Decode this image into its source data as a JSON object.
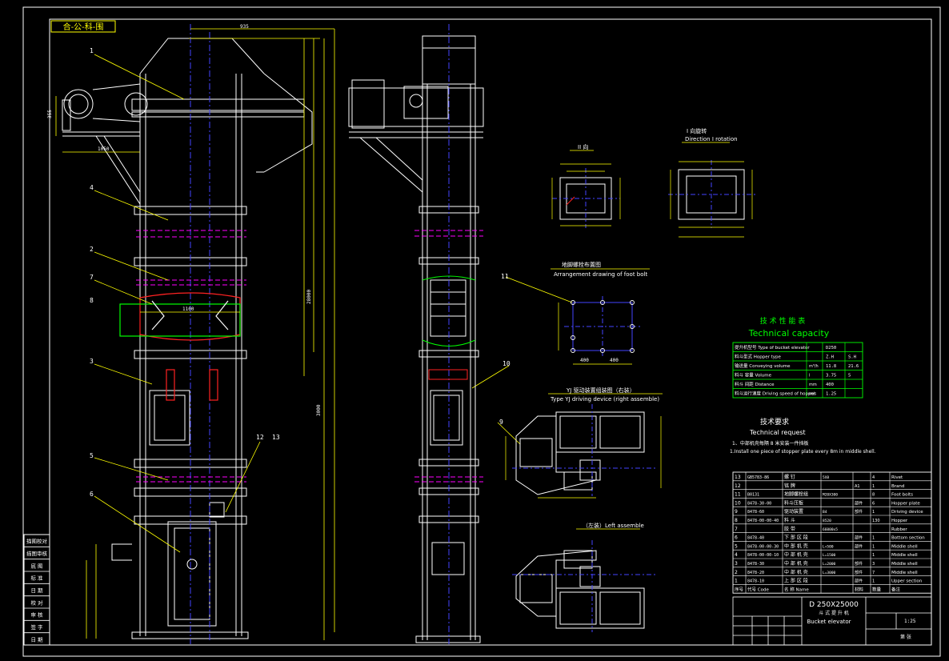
{
  "drawing": {
    "corner_label": "合-公-科-围",
    "tech": {
      "title_cn": "技 术 性 能 表",
      "title_en": "Technical capacity",
      "rows": [
        {
          "c1": "提升机型号",
          "c1b": "Type of bucket elevator",
          "c2": "",
          "c3": "D250",
          "c4": ""
        },
        {
          "c1": "料斗型式",
          "c1b": "Hopper type",
          "c2": "",
          "c3": "Z.H",
          "c4": "S.H"
        },
        {
          "c1": "输送量",
          "c1b": "Conveying volume",
          "c2": "m³/h",
          "c3": "11.8",
          "c4": "21.6"
        },
        {
          "c1": "料斗 容量",
          "c1b": "Volume",
          "c2": "l",
          "c3": "3.75",
          "c4": "5"
        },
        {
          "c1": "料斗 间距",
          "c1b": "Distance",
          "c2": "mm",
          "c3": "400",
          "c4": ""
        },
        {
          "c1": "料斗运行速度",
          "c1b": "Driving speed of hopper",
          "c2": "m/s",
          "c3": "1.25",
          "c4": ""
        }
      ]
    },
    "request": {
      "title_cn": "技术要求",
      "title_en": "Technical request",
      "line_cn": "1、中部机壳每隔 8 米安装一件挡板",
      "line_en": "1.Install one piece of stopper plate every 8m in middle shell."
    },
    "sections": {
      "viewII": "II 向",
      "viewI_cn": "I 向旋转",
      "viewI_en": "Direction I rotation",
      "foot_cn": "地脚螺栓布置图",
      "foot_en": "Arrangement drawing of foot bolt",
      "drive_cn": "YJ 驱动装置组装图（右装）",
      "drive_en": "Type YJ driving device (right assemble)",
      "left_cn": "（左装）Left assemble"
    },
    "parts": [
      {
        "no": "13",
        "code": "GB5783-86",
        "name": "螺    钉",
        "qty": "4",
        "mat": "",
        "name_en": "Rivet",
        "spec": "5X8"
      },
      {
        "no": "12",
        "code": "",
        "name": "铭    牌",
        "qty": "1",
        "mat": "A1",
        "name_en": "Brand",
        "spec": ""
      },
      {
        "no": "11",
        "code": "B0131",
        "name": "地脚螺栓组",
        "qty": "8",
        "mat": "",
        "name_en": "Foot bolts",
        "spec": "M20X300"
      },
      {
        "no": "10",
        "code": "8478-30-00",
        "name": "料斗压板",
        "qty": "6",
        "mat": "部件",
        "name_en": "Hopper plate",
        "spec": ""
      },
      {
        "no": "9",
        "code": "8478-60",
        "name": "驱动装置",
        "qty": "1",
        "mat": "部件",
        "name_en": "Driving device",
        "spec": "B4"
      },
      {
        "no": "8",
        "code": "8478-00-00-40",
        "name": "料    斗",
        "qty": "130",
        "mat": "",
        "name_en": "Hopper",
        "spec": "8520"
      },
      {
        "no": "7",
        "code": "",
        "name": "胶    带",
        "qty": "",
        "mat": "",
        "name_en": "Rubber",
        "spec": "66000x5"
      },
      {
        "no": "6",
        "code": "8478-40",
        "name": "下 部 区 段",
        "qty": "1",
        "mat": "部件",
        "name_en": "Bottom section",
        "spec": ""
      },
      {
        "no": "5",
        "code": "8478-00-00-30",
        "name": "中 部 机 壳",
        "qty": "1",
        "mat": "部件",
        "name_en": "Middle shell",
        "spec": "L=500"
      },
      {
        "no": "4",
        "code": "8478-00-00-10",
        "name": "中 部 机 壳",
        "qty": "1",
        "mat": "",
        "name_en": "Middle shell",
        "spec": "L=1500"
      },
      {
        "no": "3",
        "code": "8478-30",
        "name": "中 部 机 壳",
        "qty": "3",
        "mat": "部件",
        "name_en": "Middle shell",
        "spec": "L=2000"
      },
      {
        "no": "2",
        "code": "8478-20",
        "name": "中 部 机 壳",
        "qty": "7",
        "mat": "部件",
        "name_en": "Middle shell",
        "spec": "L=3000"
      },
      {
        "no": "1",
        "code": "8478-10",
        "name": "上 部 区 段",
        "qty": "1",
        "mat": "部件",
        "name_en": "Upper section",
        "spec": ""
      }
    ],
    "parts_header": {
      "no": "序号",
      "code": "代号 Code",
      "name": "名 称 Name",
      "qty": "数量",
      "mat": "材料",
      "note": "备注"
    },
    "title_block": {
      "model": "D 250X25000",
      "name_cn": "斗 式 提 升 机",
      "name_en": "Bucket elevator",
      "scale": "1:25",
      "sheet": "第 张"
    },
    "side_labels": [
      "描图校对",
      "描图审核",
      "底  图",
      "标  准",
      "日  期",
      "校  对",
      "审  核",
      "签  字",
      "日  期"
    ],
    "callouts": [
      "1",
      "2",
      "3",
      "4",
      "5",
      "6",
      "7",
      "8",
      "9",
      "10",
      "11",
      "12",
      "13"
    ],
    "dims": {
      "top_width": "935",
      "left_small": "355",
      "drive_dim": "1050",
      "mid_dim": "1100",
      "total_height": "28000",
      "section_height": "3000",
      "foot_w": "400",
      "foot_h": "400"
    }
  }
}
